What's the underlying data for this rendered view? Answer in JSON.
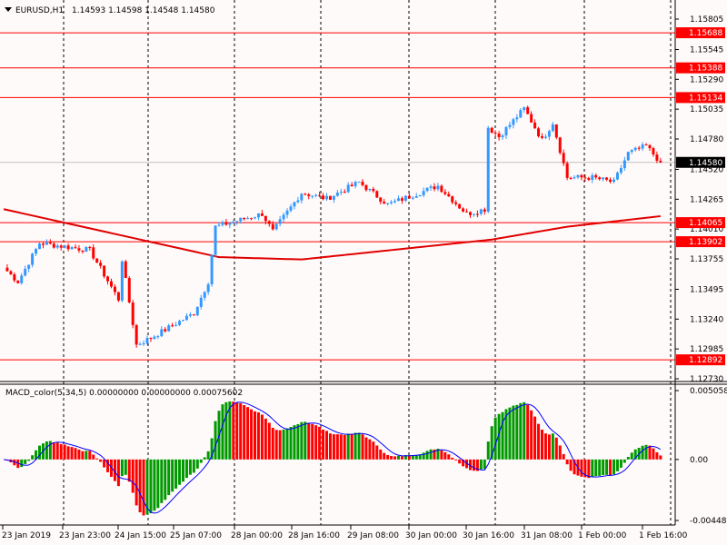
{
  "header": {
    "symbol": "EURUSD,H1",
    "ohlc": "1.14593 1.14598 1.14548 1.14580"
  },
  "colors": {
    "bull": "#3399ff",
    "bear": "#ff0000",
    "ma": "#e00000",
    "level": "#ff0000",
    "macd_up": "#009900",
    "macd_down": "#ff0000",
    "signal": "#0000ff"
  },
  "chart_data": [
    {
      "type": "candlestick",
      "title": "EURUSD,H1",
      "ylim": [
        1.1273,
        1.15805
      ],
      "price_ticks": [
        "1.15805",
        "1.15545",
        "1.15290",
        "1.15035",
        "1.14780",
        "1.14520",
        "1.14265",
        "1.14010",
        "1.13755",
        "1.13495",
        "1.13240",
        "1.12985",
        "1.12730"
      ],
      "levels": [
        "1.15688",
        "1.15388",
        "1.15134",
        "1.14065",
        "1.13902",
        "1.12892"
      ],
      "current_price": "1.14580",
      "close_waypoints": [
        [
          0,
          1.1368
        ],
        [
          4,
          1.1356
        ],
        [
          10,
          1.1389
        ],
        [
          24,
          1.1383
        ],
        [
          32,
          1.1341
        ],
        [
          33,
          1.1375
        ],
        [
          37,
          1.1302
        ],
        [
          41,
          1.1308
        ],
        [
          53,
          1.1329
        ],
        [
          57,
          1.1356
        ],
        [
          59,
          1.1403
        ],
        [
          72,
          1.1414
        ],
        [
          75,
          1.1399
        ],
        [
          83,
          1.1432
        ],
        [
          90,
          1.1427
        ],
        [
          99,
          1.1441
        ],
        [
          107,
          1.1422
        ],
        [
          121,
          1.1438
        ],
        [
          129,
          1.1414
        ],
        [
          134,
          1.1418
        ],
        [
          135,
          1.1488
        ],
        [
          138,
          1.148
        ],
        [
          145,
          1.1504
        ],
        [
          150,
          1.1477
        ],
        [
          153,
          1.1492
        ],
        [
          157,
          1.1445
        ],
        [
          164,
          1.1445
        ],
        [
          170,
          1.1441
        ],
        [
          174,
          1.1466
        ],
        [
          179,
          1.1472
        ],
        [
          183,
          1.1458
        ]
      ],
      "ma_waypoints": [
        [
          0,
          1.1418
        ],
        [
          60,
          1.1377
        ],
        [
          83,
          1.1375
        ],
        [
          136,
          1.1392
        ],
        [
          157,
          1.1403
        ],
        [
          183,
          1.1412
        ]
      ],
      "x_labels": [
        "23 Jan 2019",
        "23 Jan 23:00",
        "24 Jan 15:00",
        "25 Jan 07:00",
        "28 Jan 00:00",
        "28 Jan 16:00",
        "29 Jan 08:00",
        "30 Jan 00:00",
        "30 Jan 16:00",
        "31 Jan 08:00",
        "1 Feb 00:00",
        "1 Feb 16:00"
      ]
    },
    {
      "type": "bar",
      "title": "MACD_color(5,34,5) 0.00000000 0.00000000 0.00075602",
      "ylim": [
        -0.004481,
        0.0050587
      ],
      "ticks": [
        "0.0050587",
        "0.00",
        "-0.004481"
      ]
    }
  ]
}
